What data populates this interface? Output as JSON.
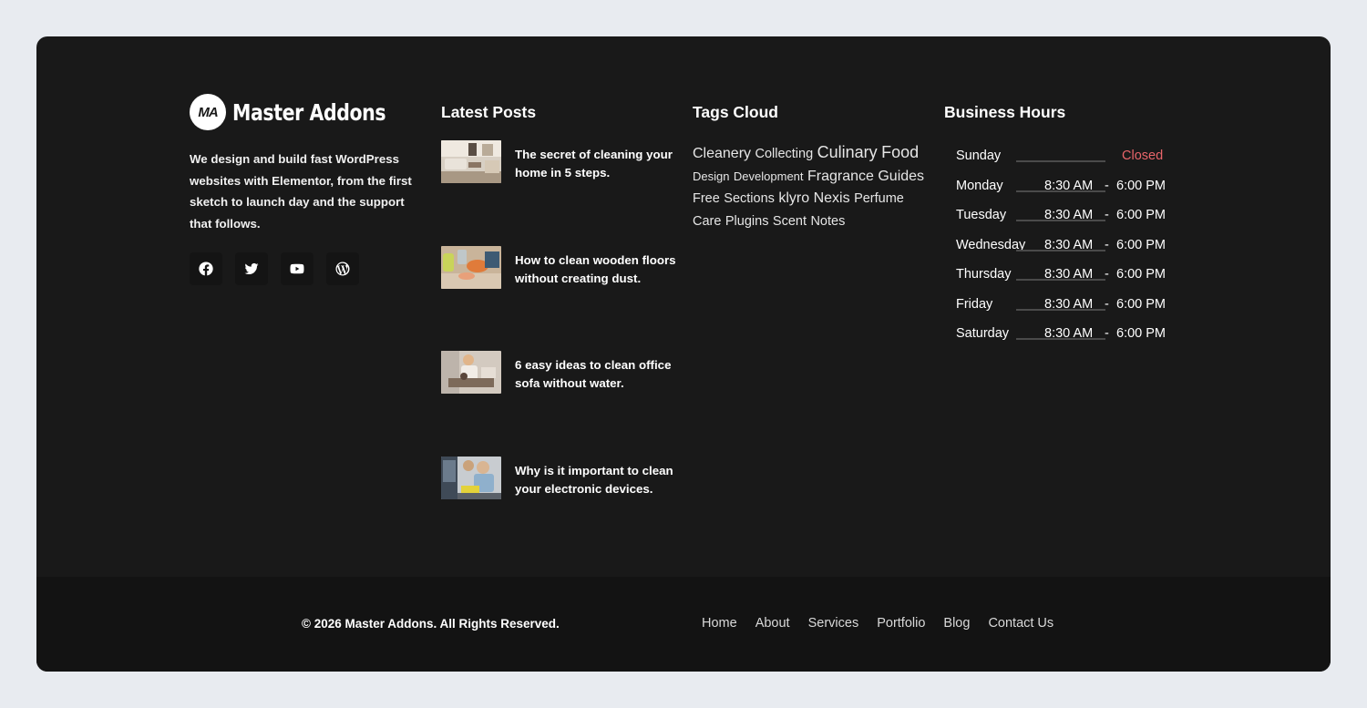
{
  "brand": {
    "logo_mark": "MA",
    "name": "Master Addons",
    "description": "We design and build fast WordPress websites with Elementor, from the first sketch to launch day and the support that follows.",
    "socials": [
      {
        "icon": "facebook-icon"
      },
      {
        "icon": "twitter-icon"
      },
      {
        "icon": "youtube-icon"
      },
      {
        "icon": "wordpress-icon"
      }
    ]
  },
  "posts": {
    "title": "Latest Posts",
    "items": [
      {
        "title": "The secret of cleaning your home in 5 steps."
      },
      {
        "title": "How to clean wooden floors without creating dust."
      },
      {
        "title": "6 easy ideas to clean office sofa without water."
      },
      {
        "title": "Why is it important to clean your electronic devices."
      }
    ]
  },
  "tags": {
    "title": "Tags Cloud",
    "items": [
      "Cleanery",
      "Collecting",
      "Culinary",
      "Food",
      "Design",
      "Development",
      "Fragrance",
      "Guides",
      "Free",
      "Sections",
      "klyro",
      "Nexis",
      "Perfume",
      "Care",
      "Plugins",
      "Scent",
      "Notes"
    ]
  },
  "hours": {
    "title": "Business Hours",
    "rows": [
      {
        "day": "Sunday",
        "status": "Closed"
      },
      {
        "day": "Monday",
        "open": "8:30 AM",
        "sep": "-",
        "close": "6:00 PM"
      },
      {
        "day": "Tuesday",
        "open": "8:30 AM",
        "sep": "-",
        "close": "6:00 PM"
      },
      {
        "day": "Wednesday",
        "open": "8:30 AM",
        "sep": "-",
        "close": "6:00 PM"
      },
      {
        "day": "Thursday",
        "open": "8:30 AM",
        "sep": "-",
        "close": "6:00 PM"
      },
      {
        "day": "Friday",
        "open": "8:30 AM",
        "sep": "-",
        "close": "6:00 PM"
      },
      {
        "day": "Saturday",
        "open": "8:30 AM",
        "sep": "-",
        "close": "6:00 PM"
      }
    ],
    "closed_color": "#e8656a"
  },
  "bottom": {
    "copyright": "© 2026 Master Addons. All Rights Reserved.",
    "nav": [
      "Home",
      "About",
      "Services",
      "Portfolio",
      "Blog",
      "Contact Us"
    ]
  }
}
